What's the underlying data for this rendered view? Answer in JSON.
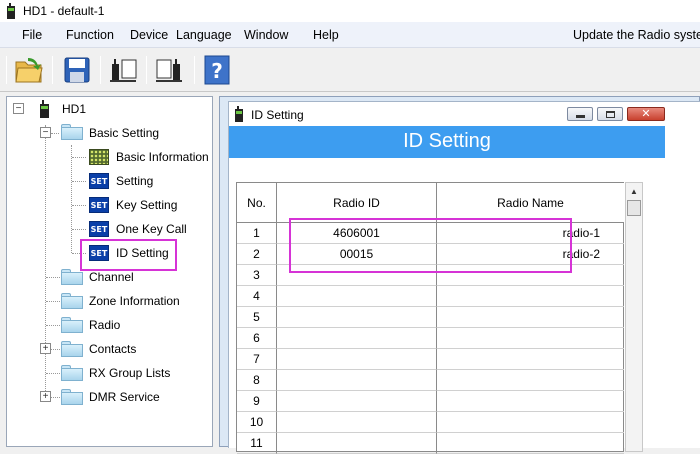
{
  "window": {
    "title": "HD1  -  default-1"
  },
  "menu": {
    "items": [
      "File",
      "Function",
      "Device",
      "Language",
      "Window",
      "Help"
    ],
    "right": "Update the Radio system"
  },
  "toolbar": {
    "buttons": [
      "open-folder-icon",
      "save-icon",
      "read-radio-icon",
      "write-radio-icon",
      "help-icon"
    ]
  },
  "tree": {
    "root": "HD1",
    "basic_setting": "Basic Setting",
    "children": [
      "Basic Information",
      "Setting",
      "Key Setting",
      "One Key Call",
      "ID Setting"
    ],
    "folders": [
      "Channel",
      "Zone Information",
      "Radio",
      "Contacts",
      "RX Group Lists",
      "DMR Service"
    ],
    "set_icon_text": "SET"
  },
  "panel": {
    "title": "ID Setting",
    "banner": "ID Setting",
    "headers": {
      "no": "No.",
      "radio_id": "Radio ID",
      "radio_name": "Radio Name"
    },
    "rows": [
      {
        "no": "1",
        "radio_id": "4606001",
        "radio_name": "radio-1"
      },
      {
        "no": "2",
        "radio_id": "00015",
        "radio_name": "radio-2"
      },
      {
        "no": "3",
        "radio_id": "",
        "radio_name": ""
      },
      {
        "no": "4",
        "radio_id": "",
        "radio_name": ""
      },
      {
        "no": "5",
        "radio_id": "",
        "radio_name": ""
      },
      {
        "no": "6",
        "radio_id": "",
        "radio_name": ""
      },
      {
        "no": "7",
        "radio_id": "",
        "radio_name": ""
      },
      {
        "no": "8",
        "radio_id": "",
        "radio_name": ""
      },
      {
        "no": "9",
        "radio_id": "",
        "radio_name": ""
      },
      {
        "no": "10",
        "radio_id": "",
        "radio_name": ""
      },
      {
        "no": "11",
        "radio_id": "",
        "radio_name": ""
      }
    ]
  },
  "colors": {
    "banner": "#3d9df0",
    "highlight": "#d633d6",
    "set_icon": "#0a3fa8"
  }
}
